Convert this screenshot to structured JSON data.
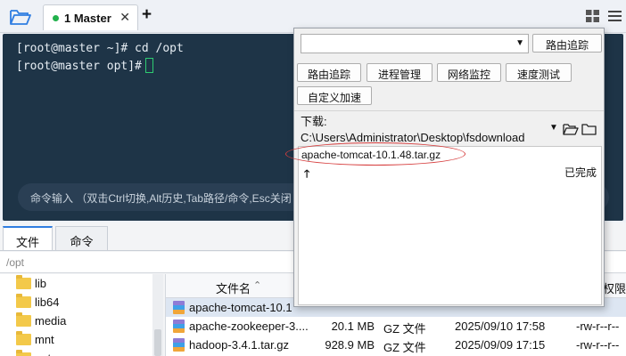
{
  "top_tabs": [
    {
      "label": "1 Master",
      "status_color": "#22b14c",
      "close": "✕"
    }
  ],
  "top_tabs_add": "+",
  "terminal": {
    "line1": "[root@master ~]# cd /opt",
    "line2": "[root@master opt]#",
    "input_placeholder": "命令输入 （双击Ctrl切换,Alt历史,Tab路径/命令,Esc关闭"
  },
  "popup": {
    "target_value": "",
    "route_trace_top": "路由追踪",
    "buttons": [
      "路由追踪",
      "进程管理",
      "网络监控",
      "速度测试",
      "自定义加速"
    ],
    "download_path": "下载: C:\\Users\\Administrator\\Desktop\\fsdownload",
    "downloads": [
      {
        "file": "apache-tomcat-10.1.48.tar.gz",
        "status": "已完成",
        "direction_icon": "up-arrow-icon"
      }
    ]
  },
  "bottom_tabs": [
    {
      "label": "文件",
      "active": true
    },
    {
      "label": "命令",
      "active": false
    }
  ],
  "path": "/opt",
  "tree": [
    "lib",
    "lib64",
    "media",
    "mnt",
    "opt"
  ],
  "file_table": {
    "columns": [
      "文件名",
      "权限"
    ],
    "rows": [
      {
        "name": "apache-tomcat-10.1",
        "size": "",
        "type": "",
        "date": "",
        "perm": ""
      },
      {
        "name": "apache-zookeeper-3....",
        "size": "20.1 MB",
        "type": "GZ 文件",
        "date": "2025/09/10 17:58",
        "perm": "-rw-r--r--"
      },
      {
        "name": "hadoop-3.4.1.tar.gz",
        "size": "928.9 MB",
        "type": "GZ 文件",
        "date": "2025/09/09 17:15",
        "perm": "-rw-r--r--"
      }
    ]
  },
  "colors": {
    "terminal_bg": "#1e3447",
    "accent": "#2f7de1",
    "highlight_ellipse": "#d63d3d"
  }
}
